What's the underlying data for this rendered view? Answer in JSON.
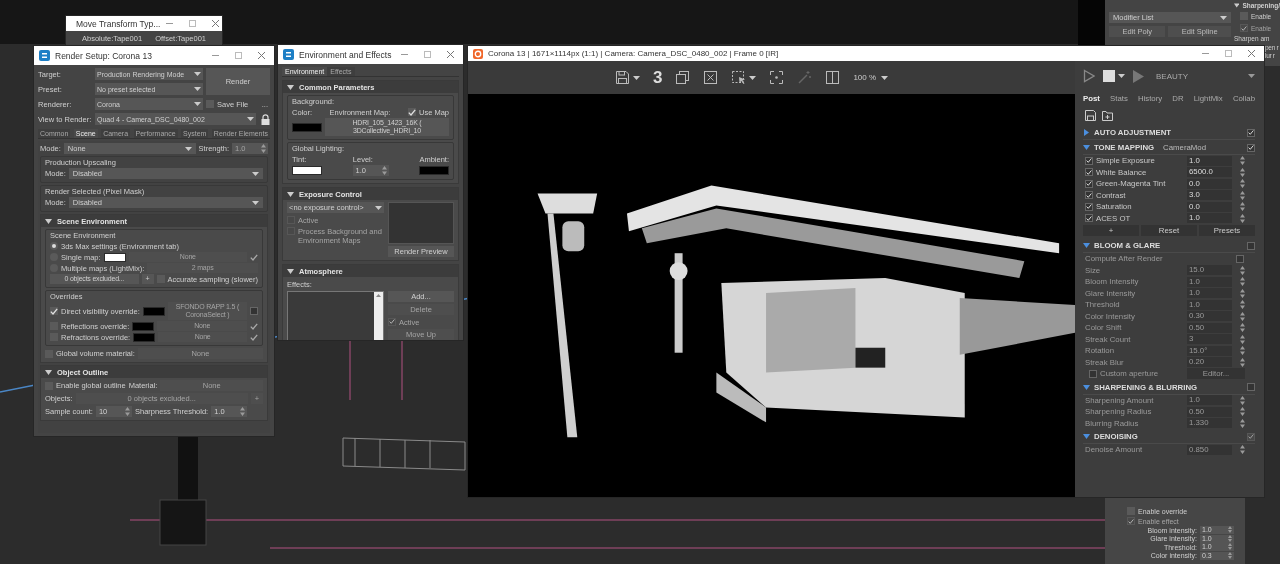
{
  "viewport": {
    "modifier_panel": {
      "dropdown": "Modifier List",
      "buttons": [
        "Edit Poly",
        "Edit Spline"
      ]
    },
    "sharpening_panel": {
      "title": "Sharpening/",
      "options": [
        {
          "label": "Enable",
          "checked": false,
          "disabled": false
        },
        {
          "label": "Enable",
          "checked": true,
          "disabled": true
        }
      ],
      "lines": [
        "Sharpen am"
      ],
      "cut_lines": [
        "pen r",
        "lur r"
      ]
    },
    "effect_panel": {
      "options": [
        {
          "label": "Enable override",
          "checked": false,
          "disabled": false
        },
        {
          "label": "Enable effect",
          "checked": true,
          "disabled": true
        }
      ],
      "fields": [
        {
          "label": "Bloom intensity:",
          "value": "1.0"
        },
        {
          "label": "Glare intensity:",
          "value": "1.0"
        },
        {
          "label": "Threshold:",
          "value": "1.0"
        },
        {
          "label": "Color intensity:",
          "value": "0.3"
        }
      ]
    }
  },
  "move_transform": {
    "title": "Move Transform Typ...",
    "labels": [
      "Absolute:Tape001",
      "Offset:Tape001"
    ]
  },
  "render_setup": {
    "title": "Render Setup: Corona 13",
    "fields": [
      {
        "label": "Target:",
        "value": "Production Rendering Mode"
      },
      {
        "label": "Preset:",
        "value": "No preset selected"
      },
      {
        "label": "Renderer:",
        "value": "Corona"
      },
      {
        "label": "View to Render:",
        "value": "Quad 4 - Camera_DSC_0480_002"
      }
    ],
    "render_button": "Render",
    "save_file": {
      "label": "Save File",
      "checked": false
    },
    "more_button": "...",
    "view_locked": true,
    "tabs": [
      {
        "label": "Common",
        "selected": false
      },
      {
        "label": "Scene",
        "selected": true
      },
      {
        "label": "Camera",
        "selected": false
      },
      {
        "label": "Performance",
        "selected": false
      },
      {
        "label": "System",
        "selected": false
      },
      {
        "label": "Render Elements",
        "selected": false
      }
    ],
    "blocks": [
      {
        "kind": "row",
        "items": [
          {
            "kind": "label",
            "text": "Mode:"
          },
          {
            "kind": "dropdown",
            "text": "None"
          },
          {
            "kind": "label",
            "text": "Strength:"
          },
          {
            "kind": "spinner",
            "value": "1.0",
            "disabled": true
          }
        ]
      },
      {
        "kind": "group",
        "title": "Production Upscaling",
        "rows": [
          [
            {
              "kind": "label",
              "text": "Mode:"
            },
            {
              "kind": "dropdown",
              "text": "Disabled"
            }
          ]
        ]
      },
      {
        "kind": "group",
        "title": "Render Selected (Pixel Mask)",
        "rows": [
          [
            {
              "kind": "label",
              "text": "Mode:"
            },
            {
              "kind": "dropdown",
              "text": "Disabled"
            }
          ]
        ]
      },
      {
        "kind": "rollout",
        "title": "Scene Environment",
        "expanded": true,
        "blocks": [
          {
            "kind": "group",
            "title": "Scene Environment",
            "rows": [
              [
                {
                  "kind": "radio",
                  "label": "3ds Max settings (Environment tab)",
                  "selected": true
                }
              ],
              [
                {
                  "kind": "radio",
                  "label": "Single map:",
                  "selected": false
                },
                {
                  "kind": "swatch",
                  "color": "#ffffff"
                },
                {
                  "kind": "button",
                  "text": "None",
                  "disabled": true
                },
                {
                  "kind": "toggle",
                  "checked": true
                }
              ],
              [
                {
                  "kind": "radio",
                  "label": "Multiple maps (LightMix):",
                  "selected": false
                },
                {
                  "kind": "button",
                  "text": "2 maps",
                  "disabled": true
                }
              ],
              [
                {
                  "kind": "button",
                  "text": "0 objects excluded..."
                },
                {
                  "kind": "small_button",
                  "text": "+"
                },
                {
                  "kind": "checkbox",
                  "label": "Accurate sampling (slower)",
                  "checked": false
                }
              ]
            ]
          },
          {
            "kind": "group",
            "title": "Overrides",
            "rows": [
              [
                {
                  "kind": "checkbox",
                  "label": "Direct visibility override:",
                  "checked": true
                },
                {
                  "kind": "swatch",
                  "color": "#000000"
                },
                {
                  "kind": "button",
                  "text": "SFONDO RAPP 1.5  ( CoronaSelect )",
                  "disabled": true
                },
                {
                  "kind": "toggle",
                  "checked": false
                }
              ],
              [
                {
                  "kind": "checkbox",
                  "label": "Reflections override:",
                  "checked": false
                },
                {
                  "kind": "swatch",
                  "color": "#000000"
                },
                {
                  "kind": "button",
                  "text": "None",
                  "disabled": true
                },
                {
                  "kind": "toggle",
                  "checked": true
                }
              ],
              [
                {
                  "kind": "checkbox",
                  "label": "Refractions override:",
                  "checked": false
                },
                {
                  "kind": "swatch",
                  "color": "#000000"
                },
                {
                  "kind": "button",
                  "text": "None",
                  "disabled": true
                },
                {
                  "kind": "toggle",
                  "checked": true
                }
              ]
            ]
          },
          {
            "kind": "row",
            "items": [
              {
                "kind": "checkbox",
                "label": "Global volume material:",
                "checked": false
              },
              {
                "kind": "button",
                "text": "None",
                "disabled": true
              }
            ]
          }
        ]
      },
      {
        "kind": "rollout",
        "title": "Object Outline",
        "expanded": true,
        "blocks": [
          {
            "kind": "row",
            "items": [
              {
                "kind": "checkbox",
                "label": "Enable global outline",
                "checked": false
              },
              {
                "kind": "label",
                "text": "Material:"
              },
              {
                "kind": "button",
                "text": "None",
                "disabled": true
              }
            ]
          },
          {
            "kind": "row",
            "items": [
              {
                "kind": "label",
                "text": "Objects:"
              },
              {
                "kind": "button",
                "text": "0 objects excluded...",
                "disabled": true
              },
              {
                "kind": "small_button",
                "text": "+",
                "disabled": true
              }
            ]
          },
          {
            "kind": "row",
            "items": [
              {
                "kind": "label",
                "text": "Sample count:"
              },
              {
                "kind": "spinner",
                "value": "10"
              },
              {
                "kind": "label",
                "text": "Sharpness Threshold:"
              },
              {
                "kind": "spinner",
                "value": "1.0"
              }
            ]
          }
        ]
      }
    ]
  },
  "environment": {
    "title": "Environment and Effects",
    "tabs": [
      {
        "label": "Environment",
        "selected": true
      },
      {
        "label": "Effects",
        "selected": false
      }
    ],
    "blocks": [
      {
        "kind": "rollout",
        "title": "Common Parameters",
        "expanded": true,
        "blocks": [
          {
            "kind": "group",
            "title": "Background:",
            "rows": [
              [
                {
                  "kind": "label",
                  "text": "Color:"
                },
                {
                  "kind": "label",
                  "text": "Environment Map:"
                },
                {
                  "kind": "checkbox",
                  "label": "Use Map",
                  "checked": true
                }
              ],
              [
                {
                  "kind": "swatch",
                  "color": "#000000"
                },
                {
                  "kind": "button",
                  "text": "HDRI_105_1423_16K ( 3DCollective_HDRI_10"
                }
              ]
            ]
          },
          {
            "kind": "group",
            "title": "Global Lighting:",
            "rows": [
              [
                {
                  "kind": "label",
                  "text": "Tint:"
                },
                {
                  "kind": "label",
                  "text": "Level:"
                },
                {
                  "kind": "label",
                  "text": "Ambient:"
                }
              ],
              [
                {
                  "kind": "swatch",
                  "color": "#ffffff"
                },
                {
                  "kind": "spinner",
                  "value": "1.0"
                },
                {
                  "kind": "swatch",
                  "color": "#000000"
                }
              ]
            ]
          }
        ]
      },
      {
        "kind": "rollout",
        "title": "Exposure Control",
        "expanded": true,
        "blocks": [
          {
            "kind": "split",
            "left": [
              {
                "kind": "row",
                "items": [
                  {
                    "kind": "dropdown",
                    "text": "<no exposure control>"
                  }
                ]
              },
              {
                "kind": "row",
                "items": [
                  {
                    "kind": "checkbox",
                    "label": "Active",
                    "checked": false,
                    "disabled": true
                  }
                ]
              },
              {
                "kind": "row",
                "items": [
                  {
                    "kind": "checkbox",
                    "label": "Process Background and Environment Maps",
                    "checked": false,
                    "disabled": true
                  }
                ]
              }
            ],
            "right": [
              {
                "kind": "row",
                "items": [
                  {
                    "kind": "preview"
                  }
                ]
              },
              {
                "kind": "row",
                "items": [
                  {
                    "kind": "button",
                    "text": "Render Preview"
                  }
                ]
              }
            ]
          }
        ]
      },
      {
        "kind": "rollout",
        "title": "Atmosphere",
        "expanded": true,
        "blocks": [
          {
            "kind": "row",
            "items": [
              {
                "kind": "label",
                "text": "Effects:"
              }
            ]
          },
          {
            "kind": "split",
            "left": [
              {
                "kind": "row",
                "items": [
                  {
                    "kind": "listbox"
                  }
                ]
              }
            ],
            "right": [
              {
                "kind": "row",
                "items": [
                  {
                    "kind": "button",
                    "text": "Add..."
                  }
                ]
              },
              {
                "kind": "row",
                "items": [
                  {
                    "kind": "button",
                    "text": "Delete",
                    "disabled": true
                  }
                ]
              },
              {
                "kind": "row",
                "items": [
                  {
                    "kind": "checkbox",
                    "label": "Active",
                    "checked": true,
                    "disabled": true
                  }
                ]
              },
              {
                "kind": "row",
                "items": [
                  {
                    "kind": "button",
                    "text": "Move Up",
                    "disabled": true
                  }
                ]
              }
            ]
          }
        ]
      }
    ]
  },
  "frame_buffer": {
    "title": "Corona 13 | 1671×1114px (1:1) | Camera: Camera_DSC_0480_002 | Frame 0 [IR]",
    "toolbar": {
      "history_count": "3",
      "zoom": "100 %"
    },
    "channel": "BEAUTY",
    "tabs": [
      {
        "label": "Post",
        "selected": true
      },
      {
        "label": "Stats",
        "selected": false
      },
      {
        "label": "History",
        "selected": false
      },
      {
        "label": "DR",
        "selected": false
      },
      {
        "label": "LightMix",
        "selected": false
      },
      {
        "label": "Collab",
        "selected": false
      }
    ],
    "sections": [
      {
        "title": "AUTO ADJUSTMENT",
        "expanded": false,
        "checked": true,
        "disabled": false
      },
      {
        "title": "TONE MAPPING",
        "subtitle": "CameraMod",
        "expanded": true,
        "checked": true,
        "disabled": false,
        "rows": [
          {
            "kind": "operator",
            "label": "Simple Exposure",
            "value": "1.0",
            "checked": true
          },
          {
            "kind": "operator",
            "label": "White Balance",
            "value": "6500.0",
            "checked": true
          },
          {
            "kind": "operator",
            "label": "Green-Magenta Tint",
            "value": "0.0",
            "checked": true
          },
          {
            "kind": "operator",
            "label": "Contrast",
            "value": "3.0",
            "checked": true
          },
          {
            "kind": "operator",
            "label": "Saturation",
            "value": "0.0",
            "checked": true
          },
          {
            "kind": "operator",
            "label": "ACES OT",
            "value": "1.0",
            "checked": true
          },
          {
            "kind": "buttons",
            "labels": [
              "+",
              "Reset",
              "Presets"
            ]
          }
        ]
      },
      {
        "title": "BLOOM & GLARE",
        "expanded": true,
        "checked": false,
        "disabled": false,
        "rows": [
          {
            "kind": "check",
            "label": "Compute After Render",
            "checked": false
          },
          {
            "kind": "param",
            "label": "Size",
            "value": "15.0"
          },
          {
            "kind": "param",
            "label": "Bloom Intensity",
            "value": "1.0"
          },
          {
            "kind": "param",
            "label": "Glare Intensity",
            "value": "1.0"
          },
          {
            "kind": "param",
            "label": "Threshold",
            "value": "1.0"
          },
          {
            "kind": "param",
            "label": "Color Intensity",
            "value": "0.30"
          },
          {
            "kind": "param",
            "label": "Color Shift",
            "value": "0.50"
          },
          {
            "kind": "param",
            "label": "Streak Count",
            "value": "3"
          },
          {
            "kind": "param",
            "label": "Rotation",
            "value": "15.0°"
          },
          {
            "kind": "param",
            "label": "Streak Blur",
            "value": "0.20"
          },
          {
            "kind": "check_button",
            "label": "Custom aperture",
            "checked": false,
            "button": "Editor..."
          }
        ]
      },
      {
        "title": "SHARPENING & BLURRING",
        "expanded": true,
        "checked": false,
        "disabled": false,
        "rows": [
          {
            "kind": "param",
            "label": "Sharpening Amount",
            "value": "1.0"
          },
          {
            "kind": "param",
            "label": "Sharpening Radius",
            "value": "0.50"
          },
          {
            "kind": "param",
            "label": "Blurring Radius",
            "value": "1.330"
          }
        ]
      },
      {
        "title": "DENOISING",
        "expanded": true,
        "checked": true,
        "disabled": true,
        "rows": [
          {
            "kind": "param",
            "label": "Denoise Amount",
            "value": "0.850"
          }
        ]
      }
    ]
  }
}
